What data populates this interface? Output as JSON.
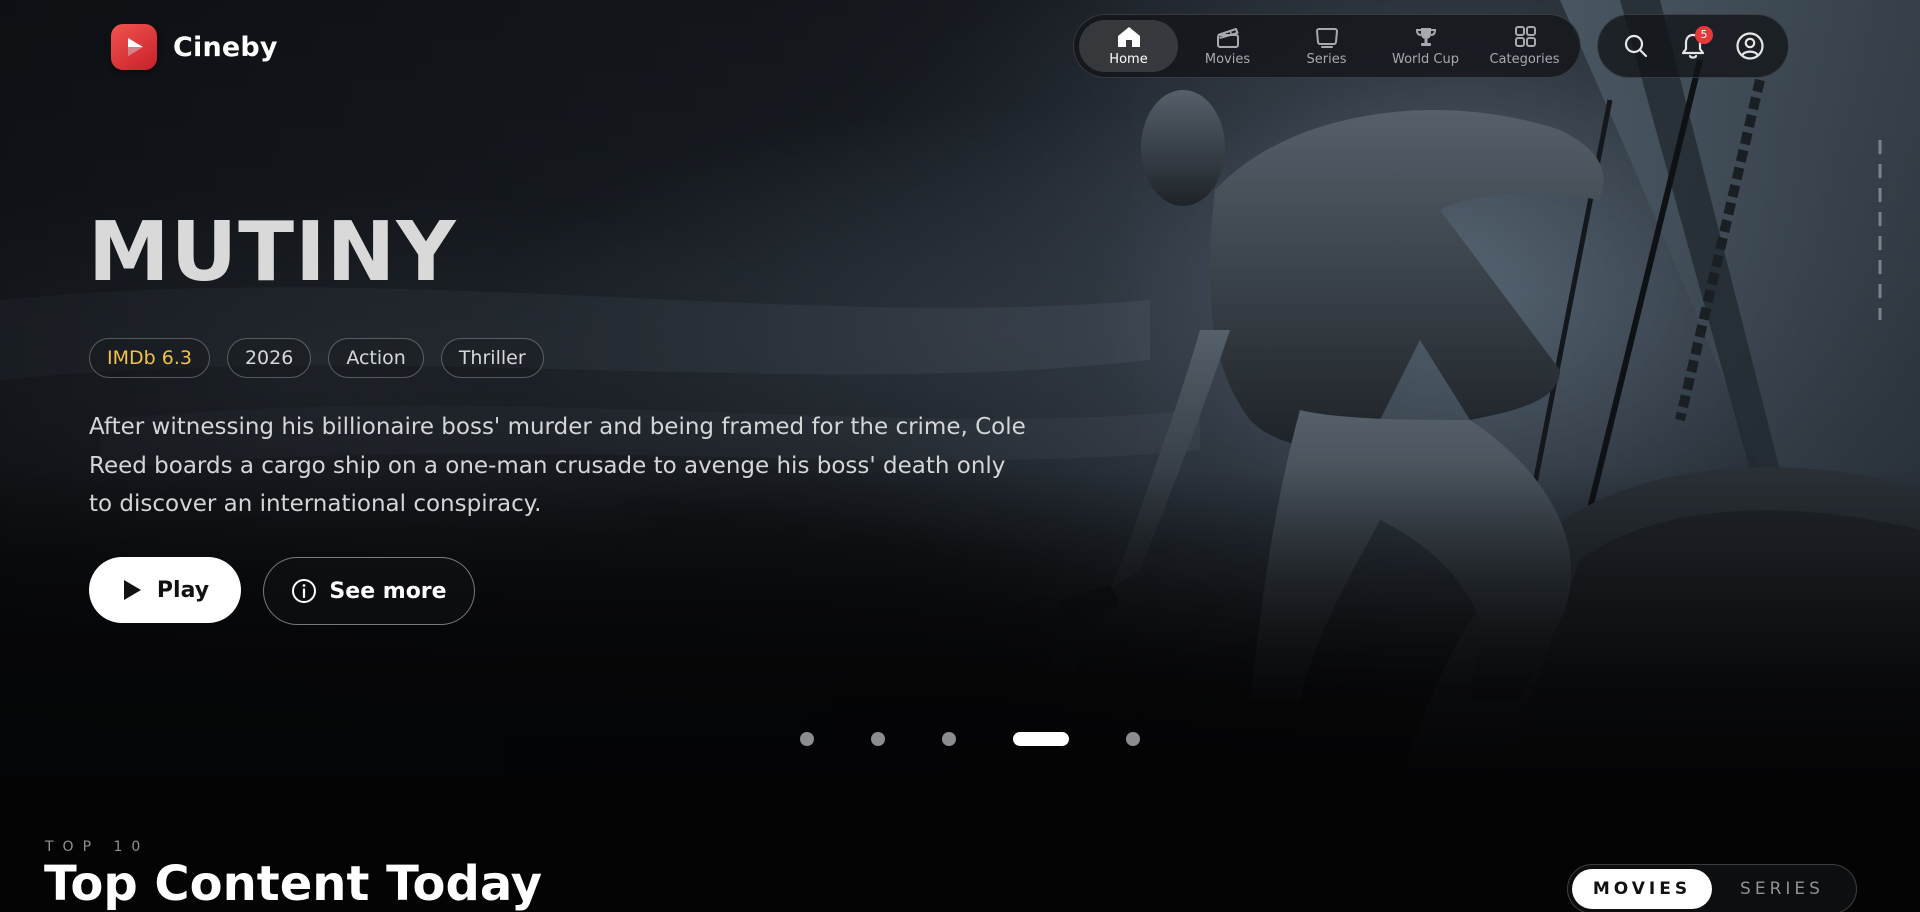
{
  "brand": {
    "name": "Cineby",
    "accent": "#e0393b",
    "icon": "play-icon"
  },
  "nav": {
    "items": [
      {
        "label": "Home",
        "icon": "home-icon",
        "active": true
      },
      {
        "label": "Movies",
        "icon": "clapperboard-icon",
        "active": false
      },
      {
        "label": "Series",
        "icon": "tv-icon",
        "active": false
      },
      {
        "label": "World Cup",
        "icon": "trophy-icon",
        "active": false
      },
      {
        "label": "Categories",
        "icon": "grid-icon",
        "active": false
      }
    ]
  },
  "actions": {
    "search_icon": "search-icon",
    "notifications_icon": "bell-icon",
    "notifications_count": "5",
    "profile_icon": "user-circle-icon"
  },
  "hero": {
    "title": "MUTINY",
    "tags": {
      "imdb": "IMDb 6.3",
      "year": "2026",
      "genre_1": "Action",
      "genre_2": "Thriller"
    },
    "imdb_color": "#f2c04d",
    "overview": "After witnessing his billionaire boss' murder and being framed for the crime, Cole Reed boards a cargo ship on a one-man crusade to avenge his boss' death only to discover an international conspiracy.",
    "play_label": "Play",
    "see_more_label": "See more",
    "slides_total": 5,
    "active_slide": 4
  },
  "top10": {
    "eyebrow": "TOP 10",
    "title": "Top Content Today",
    "toggle": {
      "movies_label": "MOVIES",
      "series_label": "SERIES",
      "active": "MOVIES"
    }
  }
}
